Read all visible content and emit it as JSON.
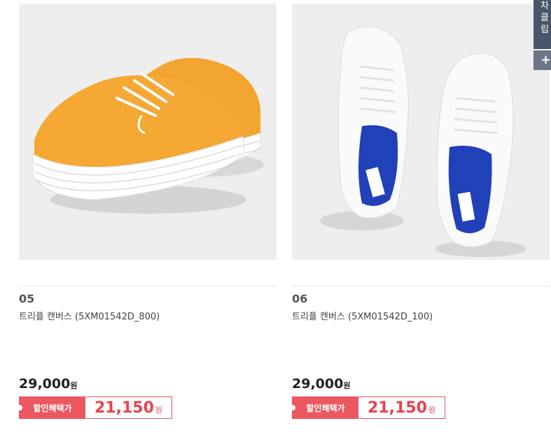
{
  "products": [
    {
      "number": "05",
      "name": "트리플 캔버스 (5XM01542D_800)",
      "price": "29,000",
      "price_unit": "원",
      "sale_label": "할인혜택가",
      "sale_price": "21,150",
      "sale_unit": "원",
      "image_icon": "orange-platform-sneakers"
    },
    {
      "number": "06",
      "name": "트리플 캔버스 (5XM01542D_100)",
      "price": "29,000",
      "price_unit": "원",
      "sale_label": "할인혜택가",
      "sale_price": "21,150",
      "sale_unit": "원",
      "image_icon": "white-canvas-sneakers"
    }
  ],
  "side_panel": {
    "lines": [
      "차",
      "클",
      "립"
    ],
    "plus": "+"
  },
  "colors": {
    "accent": "#eb5861",
    "sale_text": "#e8424c",
    "panel": "#4a5569"
  }
}
